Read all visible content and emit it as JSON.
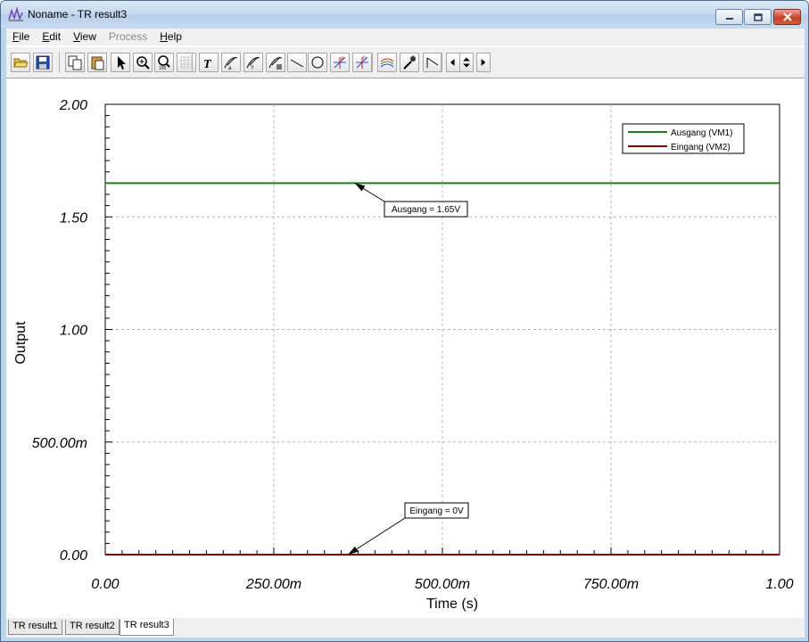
{
  "window": {
    "title": "Noname - TR result3",
    "icon": "waveform-app-icon"
  },
  "menu": [
    {
      "label": "File",
      "enabled": true
    },
    {
      "label": "Edit",
      "enabled": true
    },
    {
      "label": "View",
      "enabled": true
    },
    {
      "label": "Process",
      "enabled": false
    },
    {
      "label": "Help",
      "enabled": true
    }
  ],
  "toolbar_icons": [
    "open-folder-icon",
    "save-disk-icon",
    "copy-icon",
    "paste-icon",
    "pointer-icon",
    "zoom-in-icon",
    "zoom-fit-icon",
    "grid-icon",
    "text-icon",
    "cursor-a-icon",
    "cursor-b-icon",
    "cursor-c-icon",
    "line-icon",
    "circle-icon",
    "marker-a-icon",
    "marker-b-icon",
    "curves-icon",
    "color-pick-icon",
    "step-icon",
    "arrow-left-icon",
    "arrow-updown-icon",
    "arrow-right-icon"
  ],
  "tabs": [
    {
      "label": "TR result1",
      "active": false
    },
    {
      "label": "TR result2",
      "active": false
    },
    {
      "label": "TR result3",
      "active": true
    }
  ],
  "colors": {
    "ausgang": "#1f7a1f",
    "eingang": "#8b0000",
    "grid": "#b4b4b4"
  },
  "chart_data": {
    "type": "line",
    "xlabel": "Time (s)",
    "ylabel": "Output",
    "xlim": [
      0,
      1
    ],
    "ylim": [
      0,
      2
    ],
    "x_ticks": [
      0,
      0.25,
      0.5,
      0.75,
      1.0
    ],
    "x_tick_labels": [
      "0.00",
      "250.00m",
      "500.00m",
      "750.00m",
      "1.00"
    ],
    "y_ticks": [
      0,
      0.5,
      1.0,
      1.5,
      2.0
    ],
    "y_tick_labels": [
      "0.00",
      "500.00m",
      "1.00",
      "1.50",
      "2.00"
    ],
    "grid": true,
    "legend_position": "top-right",
    "series": [
      {
        "name": "Ausgang (VM1)",
        "color": "#1f7a1f",
        "x": [
          0,
          1
        ],
        "y": [
          1.65,
          1.65
        ]
      },
      {
        "name": "Eingang  (VM2)",
        "color": "#8b0000",
        "x": [
          0,
          1
        ],
        "y": [
          0,
          0
        ]
      }
    ],
    "annotations": [
      {
        "text": "Ausgang = 1.65V",
        "target_x": 0.37,
        "target_y": 1.65
      },
      {
        "text": "Eingang = 0V",
        "target_x": 0.36,
        "target_y": 0
      }
    ]
  }
}
